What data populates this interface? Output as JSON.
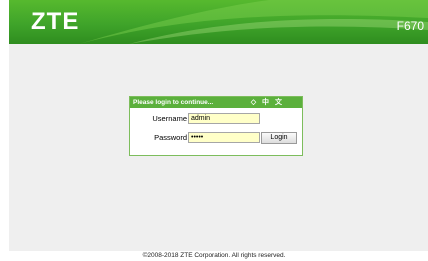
{
  "header": {
    "logo_text": "ZTE",
    "model_text": "F670",
    "brand_color": "#3fa42a"
  },
  "login": {
    "title": "Please login to continue...",
    "icons": [
      "refresh-icon",
      "chinese-icon",
      "chinese-text-icon"
    ],
    "icon_glyphs": [
      "◇",
      "中",
      "文"
    ],
    "username_label": "Username",
    "username_value": "admin",
    "password_label": "Password",
    "password_value": "•••••",
    "login_button": "Login"
  },
  "footer": {
    "copyright": "©2008-2018 ZTE Corporation. All rights reserved."
  }
}
